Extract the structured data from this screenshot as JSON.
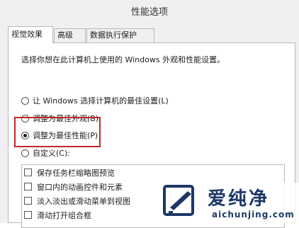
{
  "window": {
    "title": "性能选项"
  },
  "tabs": [
    {
      "label": "视觉效果",
      "active": true
    },
    {
      "label": "高级",
      "active": false
    },
    {
      "label": "数据执行保护",
      "active": false
    }
  ],
  "description": "选择你想在此计算机上使用的 Windows 外观和性能设置。",
  "options": [
    {
      "label": "让 Windows 选择计算机的最佳设置(L)",
      "checked": false
    },
    {
      "label": "调整为最佳外观(B)",
      "checked": false
    },
    {
      "label": "调整为最佳性能(P)",
      "checked": true
    },
    {
      "label": "自定义(C):",
      "checked": false
    }
  ],
  "effects": [
    {
      "label": "保存任务栏缩略图预览",
      "checked": false
    },
    {
      "label": "窗口内的动画控件和元素",
      "checked": false
    },
    {
      "label": "淡入淡出或滑动菜单到视图",
      "checked": false
    },
    {
      "label": "滑动打开组合框",
      "checked": false
    }
  ],
  "watermark": {
    "brand": "爱纯净",
    "url": "aichunjing.com"
  },
  "colors": {
    "highlight_border": "#c0282c",
    "watermark_text": "#1d3866"
  }
}
